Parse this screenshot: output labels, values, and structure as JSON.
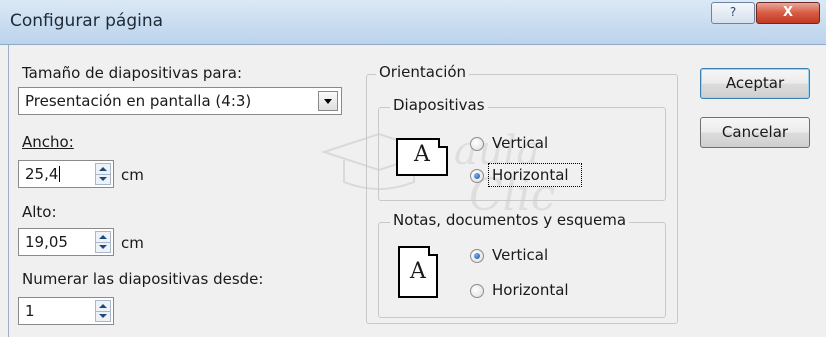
{
  "window": {
    "title": "Configurar página",
    "help_label": "?",
    "close_label": "X"
  },
  "size": {
    "label": "Tamaño de diapositivas para:",
    "selected": "Presentación en pantalla (4:3)"
  },
  "width": {
    "label": "Ancho:",
    "value": "25,4",
    "unit": "cm"
  },
  "height": {
    "label": "Alto:",
    "value": "19,05",
    "unit": "cm"
  },
  "numbering": {
    "label": "Numerar las diapositivas desde:",
    "value": "1"
  },
  "orientation": {
    "title": "Orientación",
    "slides": {
      "title": "Diapositivas",
      "icon_letter": "A",
      "options": [
        {
          "label": "Vertical",
          "checked": false
        },
        {
          "label": "Horizontal",
          "checked": true
        }
      ]
    },
    "notes": {
      "title": "Notas, documentos y esquema",
      "icon_letter": "A",
      "options": [
        {
          "label": "Vertical",
          "checked": true
        },
        {
          "label": "Horizontal",
          "checked": false
        }
      ]
    }
  },
  "buttons": {
    "ok": "Aceptar",
    "cancel": "Cancelar"
  },
  "watermark": {
    "line1": "aula",
    "line2": "Clic"
  }
}
